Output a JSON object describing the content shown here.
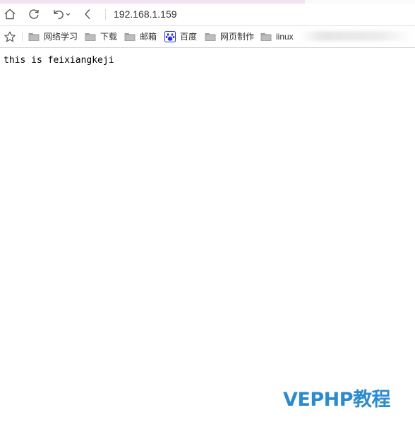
{
  "browser": {
    "address_bar": {
      "url": "192.168.1.159"
    },
    "toolbar": {
      "home_icon": "home-icon",
      "refresh_icon": "refresh-icon",
      "undo_icon": "undo-icon",
      "back_icon": "back-icon"
    },
    "bookmarks": [
      {
        "label": "网络学习",
        "icon": "folder-icon"
      },
      {
        "label": "下载",
        "icon": "folder-icon"
      },
      {
        "label": "邮箱",
        "icon": "folder-icon"
      },
      {
        "label": "百度",
        "icon": "baidu-paw-icon"
      },
      {
        "label": "网页制作",
        "icon": "folder-icon"
      },
      {
        "label": "linux",
        "icon": "folder-icon"
      }
    ]
  },
  "page": {
    "body_text": "this is feixiangkeji"
  },
  "watermark": {
    "text": "VEPHP教程"
  },
  "colors": {
    "tab_strip": "#f2e3ee",
    "watermark": "#2a8bcf",
    "baidu_blue": "#2932e1"
  }
}
